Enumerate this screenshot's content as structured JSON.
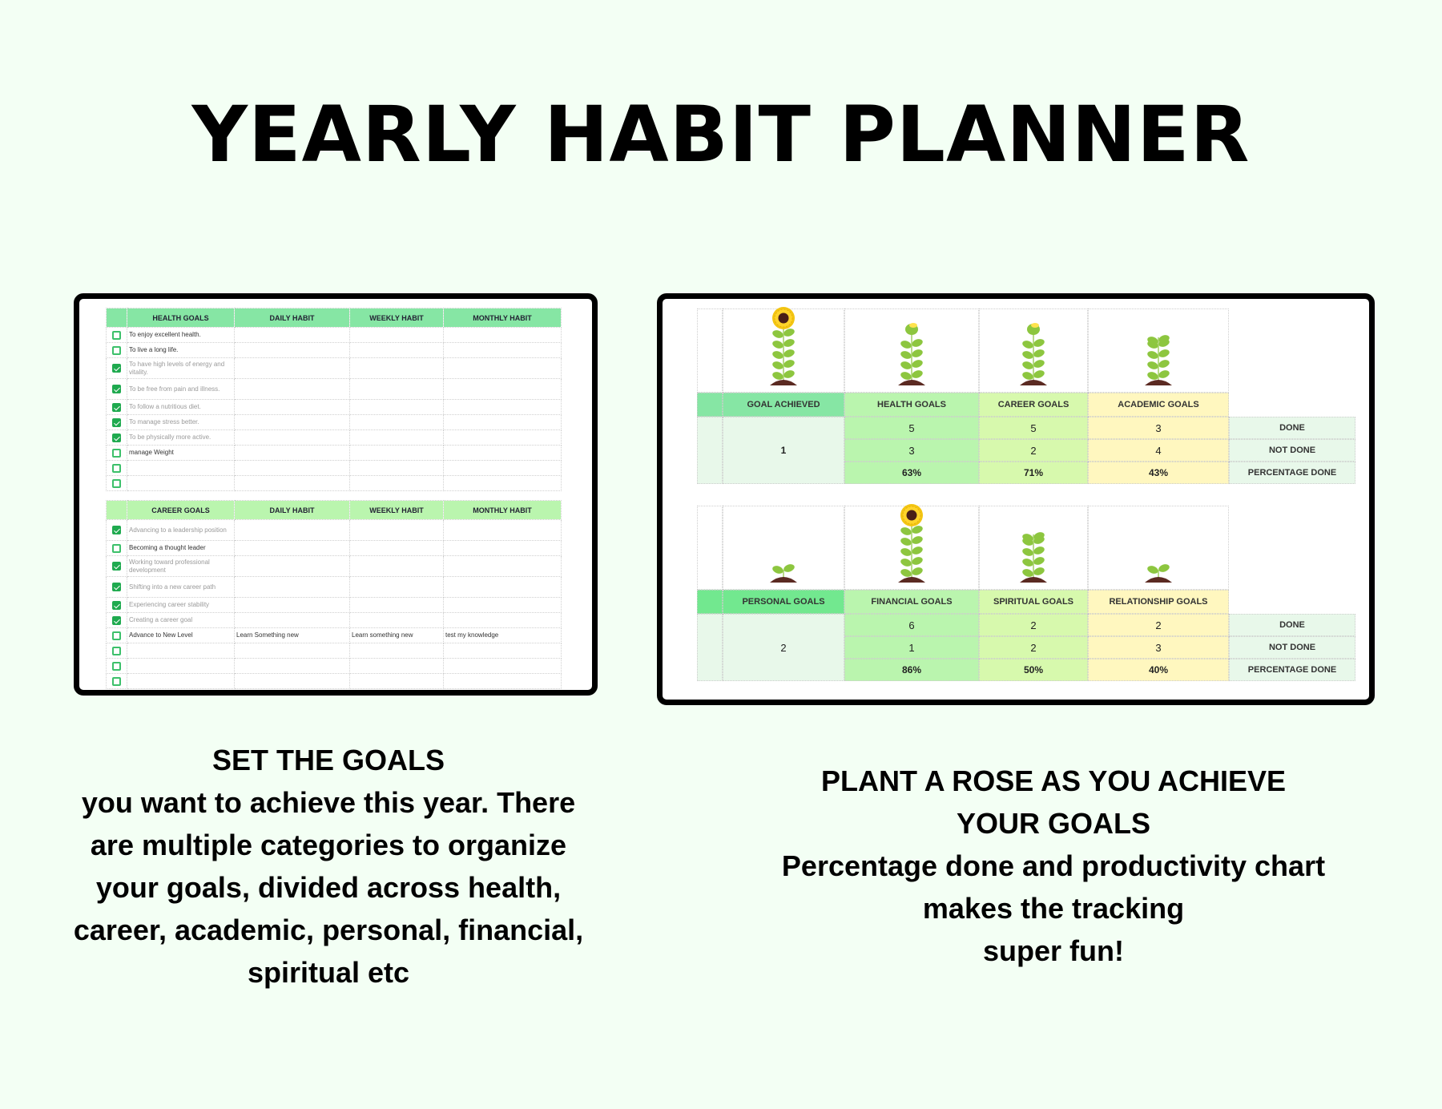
{
  "title": "YEARLY HABIT PLANNER",
  "planner": {
    "columns": [
      "DAILY HABIT",
      "WEEKLY HABIT",
      "MONTHLY HABIT"
    ],
    "sections": [
      {
        "header": "HEALTH GOALS",
        "rows": [
          {
            "checked": false,
            "goal": "To enjoy excellent health.",
            "daily": "",
            "weekly": "",
            "monthly": ""
          },
          {
            "checked": false,
            "goal": "To live a long life.",
            "daily": "",
            "weekly": "",
            "monthly": ""
          },
          {
            "checked": true,
            "goal": "To have high levels of energy and vitality.",
            "daily": "",
            "weekly": "",
            "monthly": ""
          },
          {
            "checked": true,
            "goal": "To be free from pain and illness.",
            "daily": "",
            "weekly": "",
            "monthly": ""
          },
          {
            "checked": true,
            "goal": "To follow a nutritious diet.",
            "daily": "",
            "weekly": "",
            "monthly": ""
          },
          {
            "checked": true,
            "goal": "To manage stress better.",
            "daily": "",
            "weekly": "",
            "monthly": ""
          },
          {
            "checked": true,
            "goal": "To be physically more active.",
            "daily": "",
            "weekly": "",
            "monthly": ""
          },
          {
            "checked": false,
            "goal": "manage Weight",
            "daily": "",
            "weekly": "",
            "monthly": ""
          },
          {
            "checked": false,
            "goal": "",
            "daily": "",
            "weekly": "",
            "monthly": ""
          },
          {
            "checked": false,
            "goal": "",
            "daily": "",
            "weekly": "",
            "monthly": ""
          }
        ]
      },
      {
        "header": "CAREER GOALS",
        "rows": [
          {
            "checked": true,
            "goal": "Advancing to a leadership position",
            "daily": "",
            "weekly": "",
            "monthly": ""
          },
          {
            "checked": false,
            "goal": "Becoming a thought leader",
            "daily": "",
            "weekly": "",
            "monthly": ""
          },
          {
            "checked": true,
            "goal": "Working toward professional development",
            "daily": "",
            "weekly": "",
            "monthly": ""
          },
          {
            "checked": true,
            "goal": "Shifting into a new career path",
            "daily": "",
            "weekly": "",
            "monthly": ""
          },
          {
            "checked": true,
            "goal": "Experiencing career stability",
            "daily": "",
            "weekly": "",
            "monthly": ""
          },
          {
            "checked": true,
            "goal": "Creating a career goal",
            "daily": "",
            "weekly": "",
            "monthly": ""
          },
          {
            "checked": false,
            "goal": "Advance to New Level",
            "daily": "Learn Something new",
            "weekly": "Learn something new",
            "monthly": "test my knowledge"
          },
          {
            "checked": false,
            "goal": "",
            "daily": "",
            "weekly": "",
            "monthly": ""
          },
          {
            "checked": false,
            "goal": "",
            "daily": "",
            "weekly": "",
            "monthly": ""
          },
          {
            "checked": false,
            "goal": "",
            "daily": "",
            "weekly": "",
            "monthly": ""
          }
        ]
      }
    ]
  },
  "tracker": {
    "row_labels": [
      "DONE",
      "NOT DONE",
      "PERCENTAGE DONE"
    ],
    "blocks": [
      {
        "summary_label": "GOAL ACHIEVED",
        "summary_value": "1",
        "summary_plant": "sunflower-icon",
        "categories": [
          {
            "name": "HEALTH GOALS",
            "done": "5",
            "not_done": "3",
            "percent": "63%",
            "plant": "budding-plant-icon"
          },
          {
            "name": "CAREER GOALS",
            "done": "5",
            "not_done": "2",
            "percent": "71%",
            "plant": "budding-plant-icon"
          },
          {
            "name": "ACADEMIC GOALS",
            "done": "3",
            "not_done": "4",
            "percent": "43%",
            "plant": "leafy-plant-icon"
          }
        ]
      },
      {
        "summary_label": "PERSONAL GOALS",
        "summary_value": "2",
        "summary_plant": "sprout-icon",
        "categories": [
          {
            "name": "FINANCIAL GOALS",
            "done": "6",
            "not_done": "1",
            "percent": "86%",
            "plant": "sunflower-icon"
          },
          {
            "name": "SPIRITUAL GOALS",
            "done": "2",
            "not_done": "2",
            "percent": "50%",
            "plant": "leafy-plant-icon"
          },
          {
            "name": "RELATIONSHIP GOALS",
            "done": "2",
            "not_done": "3",
            "percent": "40%",
            "plant": "sprout-icon"
          }
        ]
      }
    ]
  },
  "captions": {
    "left": [
      "SET THE GOALS",
      "you want to achieve this year. There",
      "are multiple categories to organize",
      "your goals, divided across health,",
      "career, academic, personal, financial,",
      "spiritual etc"
    ],
    "right": [
      "PLANT A ROSE AS YOU ACHIEVE",
      "YOUR GOALS",
      "Percentage done and productivity chart",
      "makes the tracking",
      "super fun!"
    ]
  },
  "colors": {
    "background": "#f3fff4",
    "health_header": "#86e6a4",
    "career_header": "#baf5ae",
    "checkbox_green": "#1faa4f",
    "yellow_cell": "#fff7bf",
    "lime_cell": "#d7f9ad"
  }
}
